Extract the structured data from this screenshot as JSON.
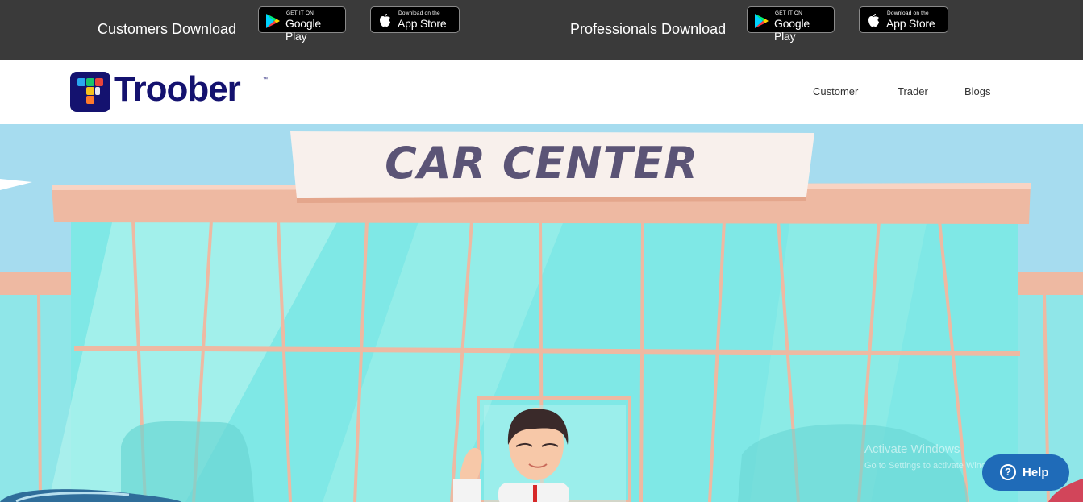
{
  "topbar": {
    "customers_label": "Customers Download",
    "professionals_label": "Professionals Download",
    "google_play": {
      "small": "GET IT ON",
      "big": "Google Play"
    },
    "app_store": {
      "small": "Download on the",
      "big": "App Store"
    }
  },
  "header": {
    "brand": "Troober",
    "trademark": "™",
    "nav": [
      "Customer",
      "Trader",
      "Blogs"
    ]
  },
  "hero": {
    "sign": "CAR CENTER"
  },
  "system": {
    "watermark_title": "Activate Windows",
    "watermark_sub": "Go to Settings to activate Windows."
  },
  "help": {
    "label": "Help",
    "icon_glyph": "?"
  },
  "colors": {
    "topbar": "#3a3a3a",
    "brand": "#14126f",
    "sky": "#a6dcef",
    "glass": "#7fe8e6",
    "help_button": "#1f6bb8"
  }
}
